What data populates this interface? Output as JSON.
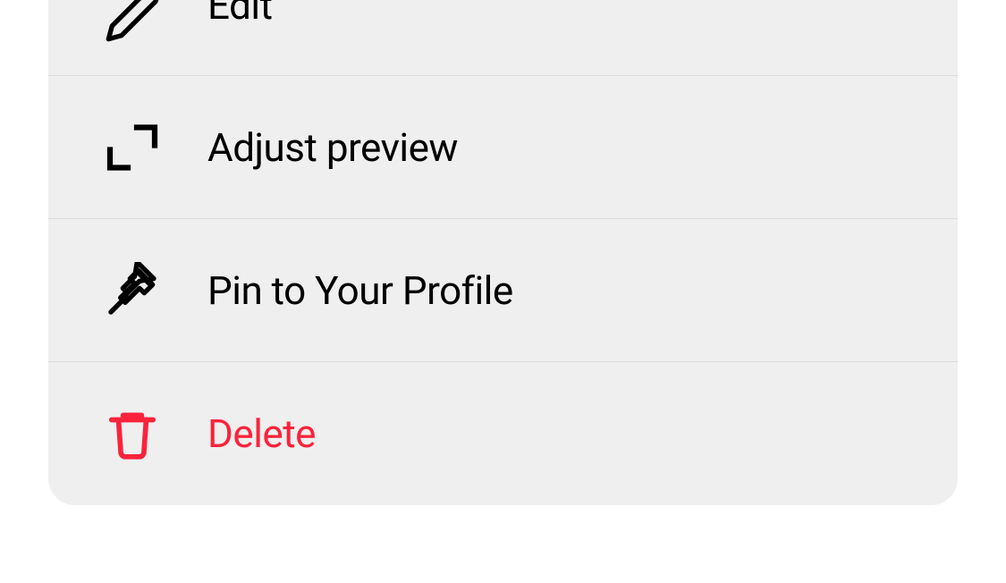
{
  "menu": {
    "items": [
      {
        "label": "Edit"
      },
      {
        "label": "Adjust preview"
      },
      {
        "label": "Pin to Your Profile"
      },
      {
        "label": "Delete"
      }
    ]
  },
  "colors": {
    "destructive": "#fa233b",
    "text": "#000000",
    "card_bg": "#efefef",
    "divider": "#dcdcdc"
  }
}
